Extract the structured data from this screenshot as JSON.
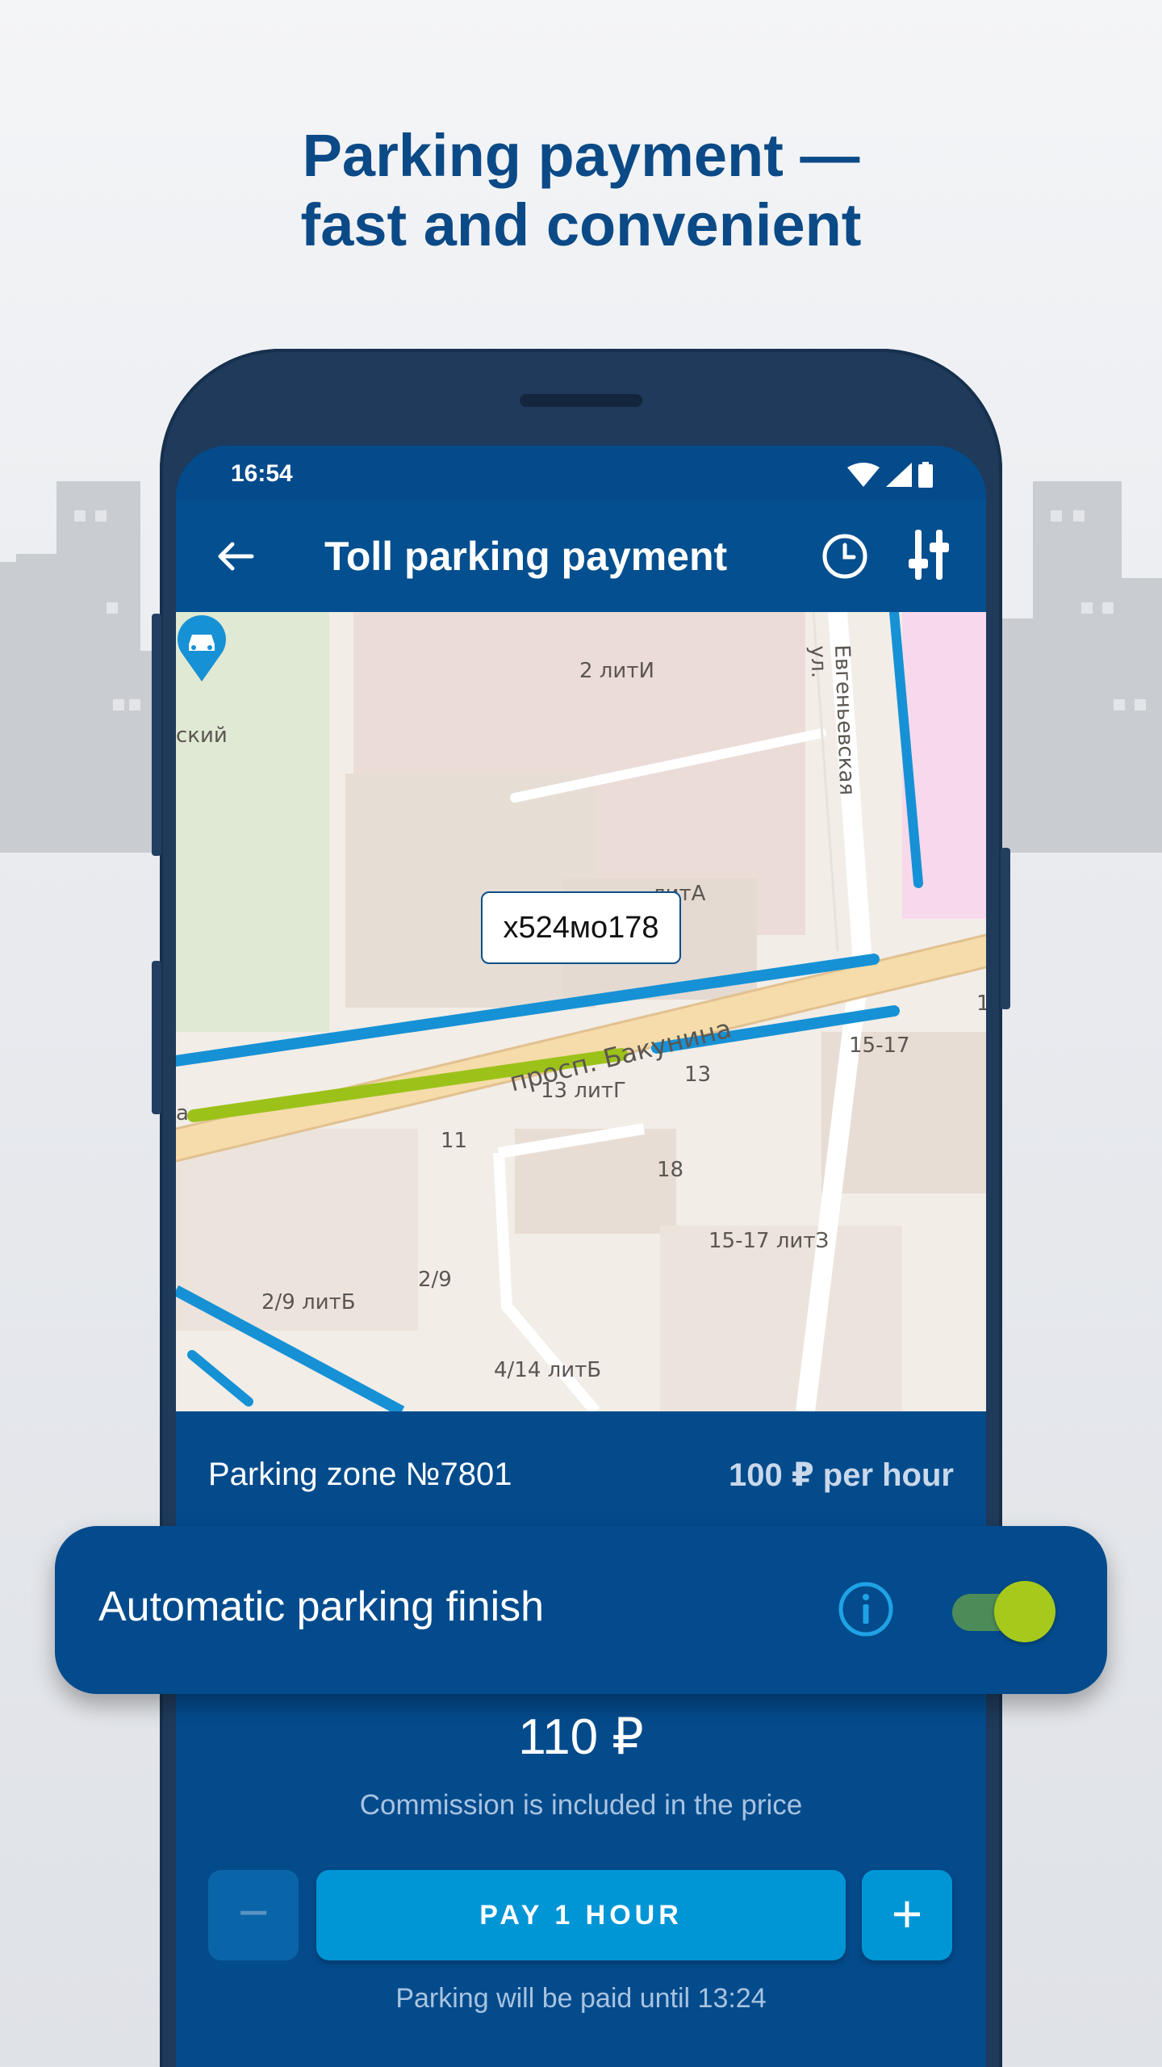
{
  "headline": {
    "line1": "Parking payment —",
    "line2": "fast and convenient"
  },
  "status_bar": {
    "time": "16:54",
    "icons": [
      "wifi-icon",
      "signal-icon",
      "battery-icon"
    ]
  },
  "app_bar": {
    "title": "Toll parking payment",
    "icons": [
      "back-arrow-icon",
      "history-clock-icon",
      "filter-sliders-icon"
    ]
  },
  "map": {
    "labels": {
      "l1": "2 литИ",
      "l2": "ский",
      "l3": "Евгеньевская ул.",
      "l4": "литА",
      "l5": "просп. Бакунина",
      "l6": "15-17",
      "l7": "13 литГ",
      "l8": "13",
      "l9": "11",
      "l10": "18",
      "l11": "15-17 литЗ",
      "l12": "2/9",
      "l13": "2/9 литБ",
      "l14": "4/14 литБ",
      "l15": "а",
      "l16": "1"
    },
    "plate": "х524мо178",
    "pin_icon": "car-pin-icon"
  },
  "zone": {
    "name": "Parking zone №7801",
    "rate": "100 ₽ per hour"
  },
  "auto_finish": {
    "label": "Automatic parking finish",
    "enabled": true,
    "info_icon": "info-icon"
  },
  "price": "110 ₽",
  "commission": "Commission is included in the price",
  "controls": {
    "minus": "−",
    "pay": "PAY 1 HOUR",
    "plus": "+"
  },
  "paid_until": "Parking will be paid until 13:24",
  "colors": {
    "brand_blue": "#044b8c",
    "accent_blue": "#0096d6",
    "parking_line_blue": "#1791d5",
    "parking_line_green": "#9cc21a",
    "toggle_knob": "#a6c91c"
  }
}
